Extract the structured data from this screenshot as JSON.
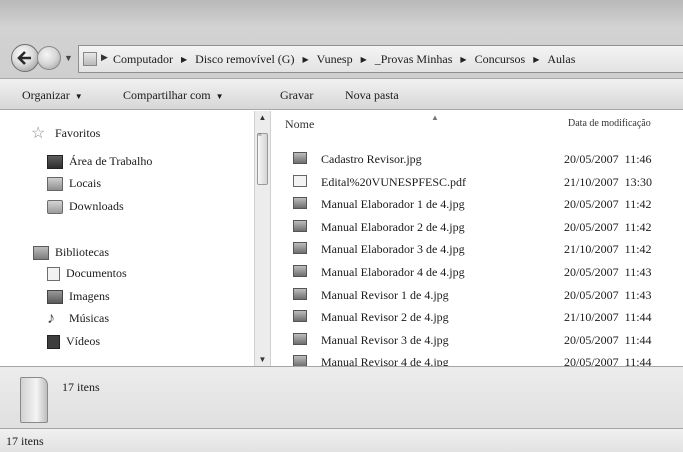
{
  "address_bar": {
    "breadcrumbs": [
      "Computador",
      "Disco removível (G)",
      "Vunesp",
      "_Provas Minhas",
      "Concursos",
      "Aulas"
    ]
  },
  "toolbar": {
    "organize_label": "Organizar",
    "share_label": "Compartilhar com",
    "burn_label": "Gravar",
    "new_folder_label": "Nova pasta"
  },
  "nav_pane": {
    "favorites_header": "Favoritos",
    "favorites": [
      {
        "label": "Área de Trabalho",
        "icon": "desktop-icon"
      },
      {
        "label": "Locais",
        "icon": "recent-places-icon"
      },
      {
        "label": "Downloads",
        "icon": "downloads-icon"
      }
    ],
    "libraries_header": "Bibliotecas",
    "libraries": [
      {
        "label": "Documentos",
        "icon": "documents-icon"
      },
      {
        "label": "Imagens",
        "icon": "pictures-icon"
      },
      {
        "label": "Músicas",
        "icon": "music-icon"
      },
      {
        "label": "Vídeos",
        "icon": "videos-icon"
      }
    ]
  },
  "file_list": {
    "columns": {
      "name": "Nome",
      "date_modified": "Data de modificação"
    },
    "rows": [
      {
        "name": "Cadastro Revisor.jpg",
        "date": "20/05/2007  11:46",
        "type": "image"
      },
      {
        "name": "Edital%20VUNESPFESC.pdf",
        "date": "21/10/2007  13:30",
        "type": "pdf"
      },
      {
        "name": "Manual Elaborador 1 de 4.jpg",
        "date": "20/05/2007  11:42",
        "type": "image"
      },
      {
        "name": "Manual Elaborador 2 de 4.jpg",
        "date": "20/05/2007  11:42",
        "type": "image"
      },
      {
        "name": "Manual Elaborador 3 de 4.jpg",
        "date": "21/10/2007  11:42",
        "type": "image"
      },
      {
        "name": "Manual Elaborador 4 de 4.jpg",
        "date": "20/05/2007  11:43",
        "type": "image"
      },
      {
        "name": "Manual Revisor 1 de 4.jpg",
        "date": "20/05/2007  11:43",
        "type": "image"
      },
      {
        "name": "Manual Revisor 2 de 4.jpg",
        "date": "21/10/2007  11:44",
        "type": "image"
      },
      {
        "name": "Manual Revisor 3 de 4.jpg",
        "date": "20/05/2007  11:44",
        "type": "image"
      },
      {
        "name": "Manual Revisor 4 de 4.jpg",
        "date": "20/05/2007  11:44",
        "type": "image"
      }
    ]
  },
  "details_pane": {
    "item_count": "17 itens"
  },
  "status_bar": {
    "text": "17 itens"
  }
}
